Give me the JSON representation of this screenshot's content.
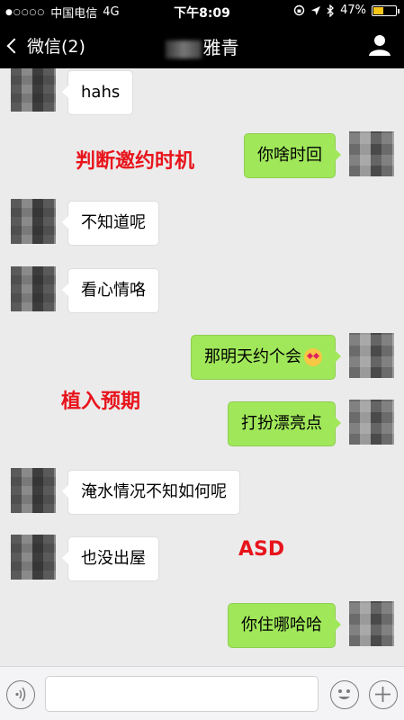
{
  "status_bar": {
    "signal": "●○○○○",
    "carrier": "中国电信",
    "network": "4G",
    "time": "下午8:09",
    "battery": "47%",
    "battery_level": 0.47
  },
  "nav": {
    "back_label": "微信(2)",
    "title": "雅青"
  },
  "messages": [
    {
      "side": "left",
      "text": "hahs"
    },
    {
      "side": "right",
      "text": "你啥时回"
    },
    {
      "side": "left",
      "text": "不知道呢"
    },
    {
      "side": "left",
      "text": "看心情咯"
    },
    {
      "side": "right",
      "text": "那明天约个会",
      "emoji": "heart-eyes-emoji"
    },
    {
      "side": "right",
      "text": "打扮漂亮点"
    },
    {
      "side": "left",
      "text": "淹水情况不知如何呢"
    },
    {
      "side": "left",
      "text": "也没出屋"
    },
    {
      "side": "right",
      "text": "你住哪哈哈"
    }
  ],
  "annotations": [
    {
      "text": "判断邀约时机",
      "color": "#e8141c"
    },
    {
      "text": "植入预期",
      "color": "#e8141c"
    },
    {
      "text": "ASD",
      "color": "#e8141c"
    }
  ],
  "input_bar": {
    "voice_icon": "voice-icon",
    "emoji_icon": "emoji-icon",
    "add_icon": "add-icon"
  }
}
